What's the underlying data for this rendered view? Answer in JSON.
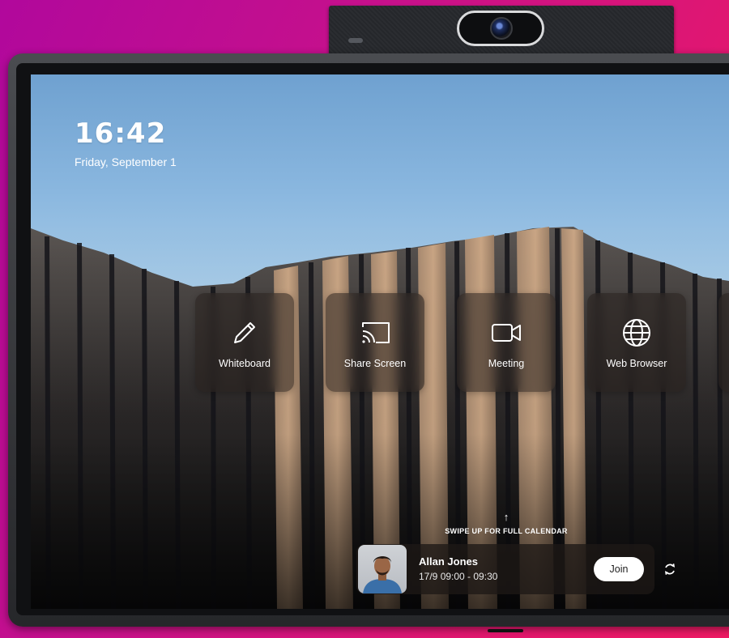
{
  "clock": {
    "time": "16:42",
    "date": "Friday, September 1"
  },
  "tiles": [
    {
      "label": "Whiteboard",
      "icon": "pencil-icon"
    },
    {
      "label": "Share Screen",
      "icon": "cast-icon"
    },
    {
      "label": "Meeting",
      "icon": "video-camera-icon"
    },
    {
      "label": "Web Browser",
      "icon": "globe-icon"
    }
  ],
  "calendar": {
    "swipe_hint": "SWIPE UP FOR FULL CALENDAR",
    "swipe_arrow": "↑",
    "next_meeting": {
      "name": "Allan Jones",
      "time": "17/9 09:00 - 09:30",
      "join_label": "Join"
    }
  },
  "colors": {
    "background_gradient_start": "#b1089c",
    "background_gradient_end": "#ef1a64",
    "tile_background": "#28201e",
    "join_button": "#ffffff"
  }
}
